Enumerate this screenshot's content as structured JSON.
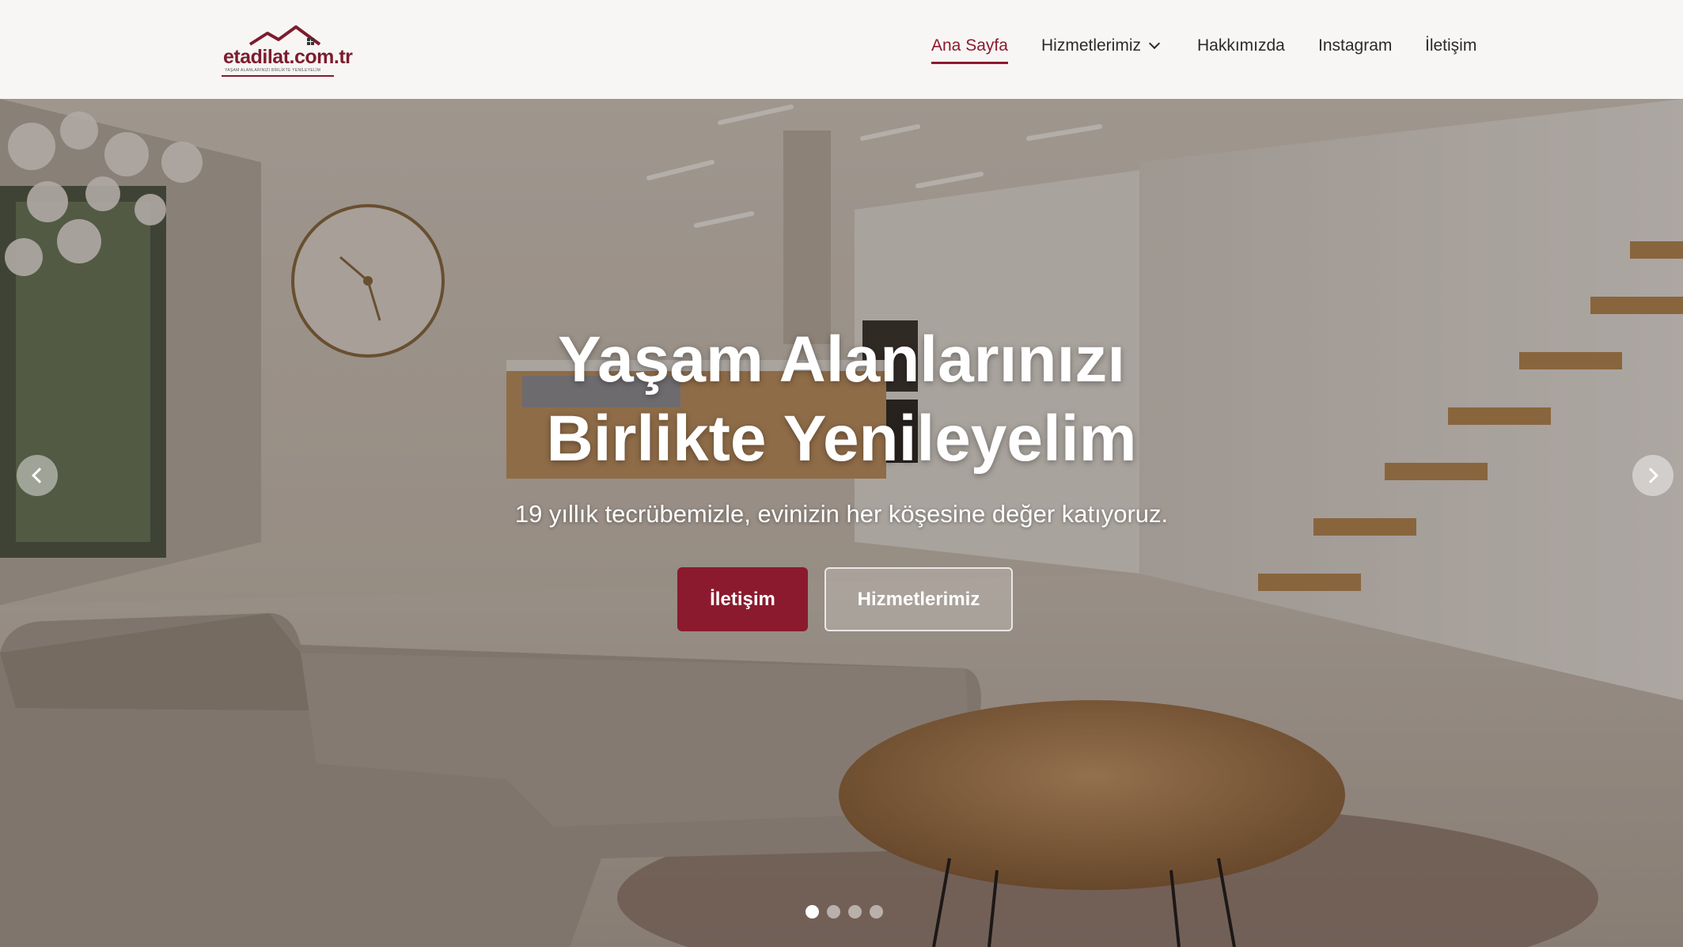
{
  "logo": {
    "text": "etadilat.com.tr",
    "tagline": "YAŞAM ALANLARINIZI BİRLİKTE YENİLEYELİM"
  },
  "nav": {
    "items": [
      {
        "label": "Ana Sayfa",
        "active": true
      },
      {
        "label": "Hizmetlerimiz",
        "has_dropdown": true
      },
      {
        "label": "Hakkımızda"
      },
      {
        "label": "Instagram"
      },
      {
        "label": "İletişim"
      }
    ]
  },
  "hero": {
    "title_line1": "Yaşam Alanlarınızı",
    "title_line2": "Birlikte Yenileyelim",
    "subtitle": "19 yıllık tecrübemizle, evinizin her köşesine değer katıyoruz.",
    "primary_button": "İletişim",
    "secondary_button": "Hizmetlerimiz",
    "slides_total": 4,
    "active_slide": 1
  },
  "colors": {
    "brand": "#8b1a2e",
    "header_bg": "#f7f6f4",
    "text": "#2b2b2b"
  },
  "icons": {
    "prev": "chevron-left-icon",
    "next": "chevron-right-icon",
    "dropdown": "chevron-down-icon"
  }
}
